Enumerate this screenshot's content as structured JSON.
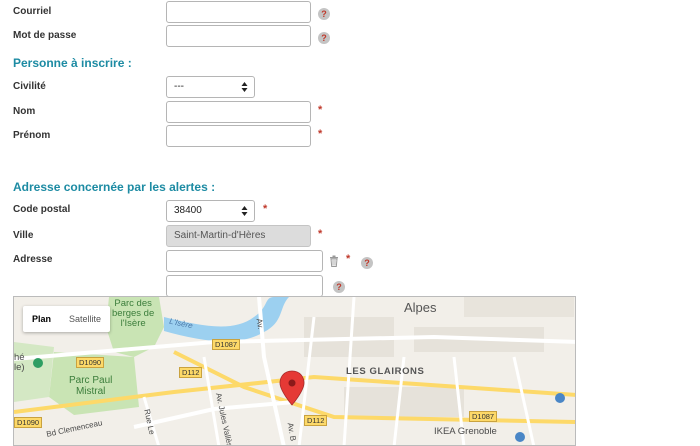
{
  "form": {
    "courriel_label": "Courriel",
    "password_label": "Mot de passe",
    "section_person": "Personne à inscrire :",
    "civilite_label": "Civilité",
    "civilite_value": "---",
    "nom_label": "Nom",
    "prenom_label": "Prénom",
    "section_address": "Adresse concernée par les alertes :",
    "cp_label": "Code postal",
    "cp_value": "38400",
    "ville_label": "Ville",
    "ville_value": "Saint-Martin-d'Hères",
    "adresse_label": "Adresse",
    "help_glyph": "?",
    "required_glyph": "*",
    "delete_icon": "trash-icon"
  },
  "map": {
    "types": [
      "Plan",
      "Satellite"
    ],
    "active_type": "Plan",
    "places": {
      "alpes": "Alpes",
      "glairons": "LES GLAIRONS",
      "parc_berges": "Parc des\nberges de\nl'Isère",
      "parc_paul": "Parc Paul\nMistral",
      "isere": "L'Isère",
      "ikea": "IKEA Grenoble",
      "clemenceau": "Bd Clemenceau",
      "av_jules": "Av. Jules Vallès",
      "rue_le": "Rue Le",
      "av_b": "Av. B",
      "che": "hé\nle)",
      "av_gab": "Av."
    },
    "roads": [
      "D1090",
      "D1087",
      "D112",
      "D112",
      "D1087",
      "D1090"
    ],
    "colors": {
      "park": "#c9e4b4",
      "water": "#9cd0f0",
      "road_major": "#fdd969",
      "pin": "#e53935",
      "section_title": "#1d8ba3",
      "required": "#c0392b"
    }
  }
}
